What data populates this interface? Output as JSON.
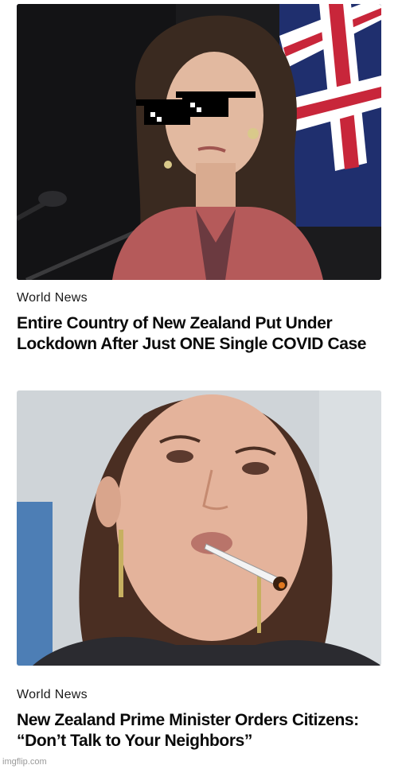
{
  "articles": [
    {
      "category": "World News",
      "headline": "Entire Country of New Zealand Put Under Lockdown After Just ONE Single COVID Case",
      "image_semantic": "woman-at-press-conference-with-pixel-sunglasses"
    },
    {
      "category": "World News",
      "headline": "New Zealand Prime Minister Orders Citizens: “Don’t Talk to Your Neighbors”",
      "image_semantic": "woman-closeup-with-joint"
    }
  ],
  "watermark": "imgflip.com",
  "colors": {
    "background": "#ffffff",
    "text": "#111111",
    "flag_blue": "#1f2f6e",
    "flag_red": "#c8263a",
    "blazer": "#b55a5a"
  }
}
